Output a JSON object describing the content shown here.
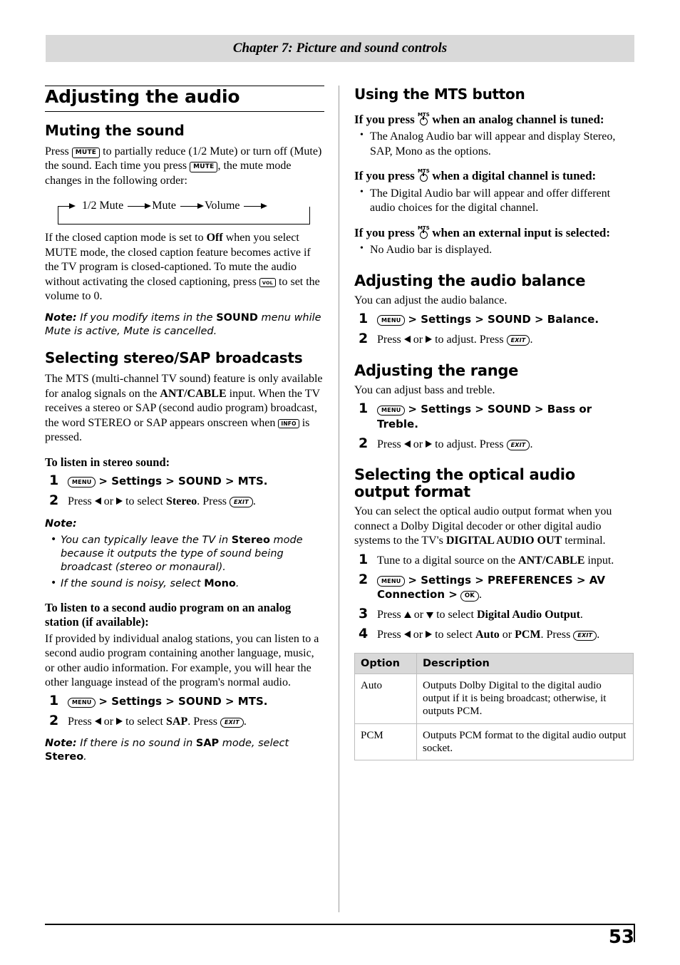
{
  "header": {
    "chapter": "Chapter 7: Picture and sound controls"
  },
  "page_number": "53",
  "left": {
    "title": "Adjusting the audio",
    "muting": {
      "heading": "Muting the sound",
      "p1_a": "Press",
      "key_mute1": "MUTE",
      "p1_b": "to partially reduce (1/2 Mute) or turn off (Mute) the sound. Each time you press",
      "key_mute2": "MUTE",
      "p1_c": ", the mute mode changes in the following order:",
      "flow": [
        "1/2 Mute",
        "Mute",
        "Volume"
      ],
      "p2_a": "If the closed caption mode is set to",
      "p2_off": "Off",
      "p2_b": "when you select MUTE mode, the closed caption feature becomes active if the TV program is closed-captioned. To mute the audio without activating the closed captioning, press",
      "key_vol": "VOL",
      "p2_c": "to set the volume to 0.",
      "note_label": "Note:",
      "note_a": "If you modify items in the",
      "note_b": "SOUND",
      "note_c": "menu while Mute is active, Mute is cancelled."
    },
    "stereo": {
      "heading": "Selecting stereo/SAP broadcasts",
      "p1_a": "The MTS (multi-channel TV sound) feature is only available for analog signals on the",
      "p1_b": "ANT/CABLE",
      "p1_c": "input. When the TV receives a stereo or SAP (second audio program) broadcast, the word STEREO or SAP appears onscreen when",
      "key_info": "INFO",
      "p1_d": "is pressed.",
      "sub1": "To listen in stereo sound:",
      "steps1": [
        {
          "num": "1",
          "menu_key": "MENU",
          "path": "> Settings > SOUND > MTS."
        },
        {
          "num": "2",
          "text_a": "Press",
          "text_b": "or",
          "text_c": "to select",
          "bold": "Stereo",
          "text_d": ". Press",
          "exit_key": "EXIT",
          "text_e": "."
        }
      ],
      "note_label": "Note:",
      "note_bullets": [
        {
          "a": "You can typically leave the TV in",
          "b": "Stereo",
          "c": "mode because it outputs the type of sound being broadcast (stereo or monaural)."
        },
        {
          "a": "If the sound is noisy, select",
          "b": "Mono",
          "c": "."
        }
      ],
      "sub2": "To listen to a second audio program on an analog station (if available):",
      "p2": "If provided by individual analog stations, you can listen to a second audio program containing another language, music, or other audio information. For example, you will hear the other language instead of the program's normal audio.",
      "steps2": [
        {
          "num": "1",
          "menu_key": "MENU",
          "path": "> Settings > SOUND > MTS."
        },
        {
          "num": "2",
          "text_a": "Press",
          "text_b": "or",
          "text_c": "to select",
          "bold": "SAP",
          "text_d": ". Press",
          "exit_key": "EXIT",
          "text_e": "."
        }
      ],
      "note2_label": "Note:",
      "note2_a": "If there is no sound in",
      "note2_b": "SAP",
      "note2_c": "mode, select",
      "note2_d": "Stereo",
      "note2_e": "."
    }
  },
  "right": {
    "mts": {
      "heading": "Using the MTS button",
      "case1": {
        "pre": "If you press",
        "post": "when an analog channel is tuned:",
        "bullet": "The Analog Audio bar will appear and display Stereo, SAP, Mono as the options."
      },
      "case2": {
        "pre": "If you press",
        "post": "when a digital channel is tuned:",
        "bullet": "The Digital Audio bar will appear and offer different audio choices for the digital channel."
      },
      "case3": {
        "pre": "If you press",
        "post": "when an external input is selected:",
        "bullet": "No Audio bar is displayed."
      }
    },
    "balance": {
      "heading": "Adjusting the audio balance",
      "intro": "You can adjust the audio balance.",
      "steps": [
        {
          "num": "1",
          "menu_key": "MENU",
          "path": "> Settings > SOUND > Balance."
        },
        {
          "num": "2",
          "text_a": "Press",
          "text_b": "or",
          "text_c": "to adjust. Press",
          "exit_key": "EXIT",
          "text_d": "."
        }
      ]
    },
    "range": {
      "heading": "Adjusting the range",
      "intro": "You can adjust bass and treble.",
      "steps": [
        {
          "num": "1",
          "menu_key": "MENU",
          "path": "> Settings > SOUND > Bass or Treble."
        },
        {
          "num": "2",
          "text_a": "Press",
          "text_b": "or",
          "text_c": "to adjust. Press",
          "exit_key": "EXIT",
          "text_d": "."
        }
      ]
    },
    "optical": {
      "heading": "Selecting the optical audio output format",
      "intro_a": "You can select the optical audio output format when you connect a Dolby Digital decoder or other digital audio systems to the TV's",
      "intro_b": "DIGITAL AUDIO OUT",
      "intro_c": "terminal.",
      "steps": [
        {
          "num": "1",
          "text_a": "Tune to a digital source on the",
          "bold": "ANT/CABLE",
          "text_b": "input."
        },
        {
          "num": "2",
          "menu_key": "MENU",
          "path": "> Settings > PREFERENCES > AV Connection >",
          "ok_key": "OK",
          "tail": "."
        },
        {
          "num": "3",
          "text_a": "Press",
          "text_b": "or",
          "text_c": "to select",
          "bold": "Digital Audio Output",
          "text_d": "."
        },
        {
          "num": "4",
          "text_a": "Press",
          "text_b": "or",
          "text_c": "to select",
          "bold1": "Auto",
          "text_or": "or",
          "bold2": "PCM",
          "text_d": ". Press",
          "exit_key": "EXIT",
          "text_e": "."
        }
      ],
      "table": {
        "headers": [
          "Option",
          "Description"
        ],
        "rows": [
          {
            "option": "Auto",
            "description": "Outputs Dolby Digital to the digital audio output if it is being broadcast; otherwise, it outputs PCM."
          },
          {
            "option": "PCM",
            "description": "Outputs PCM format to the digital audio output socket."
          }
        ]
      }
    }
  }
}
